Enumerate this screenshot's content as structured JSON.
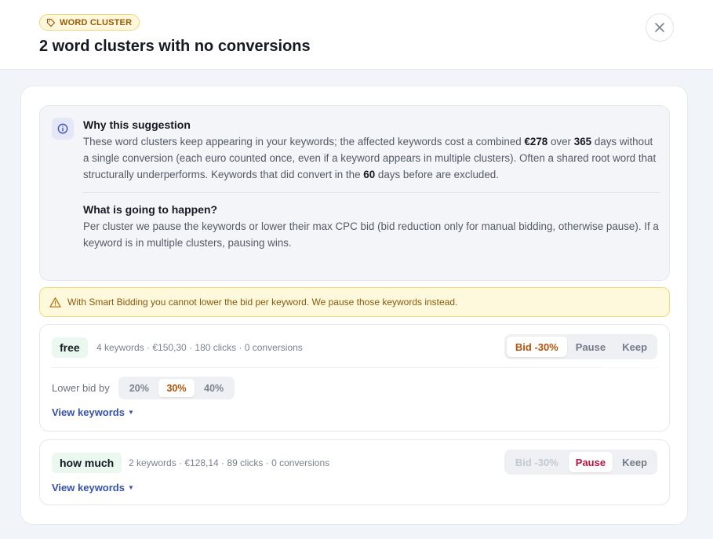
{
  "header": {
    "tag_label": "WORD CLUSTER",
    "title": "2 word clusters with no conversions",
    "tag_icon": "tag-icon",
    "close_icon": "close-icon"
  },
  "info": {
    "icon": "info-icon",
    "why_heading": "Why this suggestion",
    "why_text_1": "These word clusters keep appearing in your keywords; the affected keywords cost a combined ",
    "why_cost": "€278",
    "why_text_2": " over ",
    "why_days": "365",
    "why_text_3": " days without a single conversion (each euro counted once, even if a keyword appears in multiple clusters). Often a shared root word that structurally underperforms. Keywords that did convert in the ",
    "why_excl_days": "60",
    "why_text_4": " days before are excluded.",
    "what_heading": "What is going to happen?",
    "what_text": "Per cluster we pause the keywords or lower their max CPC bid (bid reduction only for manual bidding, otherwise pause). If a keyword is in multiple clusters, pausing wins."
  },
  "warning": {
    "icon": "warning-icon",
    "text": "With Smart Bidding you cannot lower the bid per keyword. We pause those keywords instead."
  },
  "actions": {
    "bid": "Bid -30%",
    "pause": "Pause",
    "keep": "Keep"
  },
  "clusters": [
    {
      "name": "free",
      "meta": "4 keywords · €150,30 · 180 clicks · 0 conversions",
      "selected_action": "bid",
      "lower_bid_label": "Lower bid by",
      "bid_options": [
        "20%",
        "30%",
        "40%"
      ],
      "selected_bid": "30%",
      "view_keywords": "View keywords"
    },
    {
      "name": "how much",
      "meta": "2 keywords · €128,14 · 89 clicks · 0 conversions",
      "selected_action": "pause",
      "view_keywords": "View keywords"
    }
  ],
  "colors": {
    "accent_bid": "#b45309",
    "accent_pause": "#be123c",
    "link": "#3451b2",
    "warning_bg": "#fef8dc"
  }
}
